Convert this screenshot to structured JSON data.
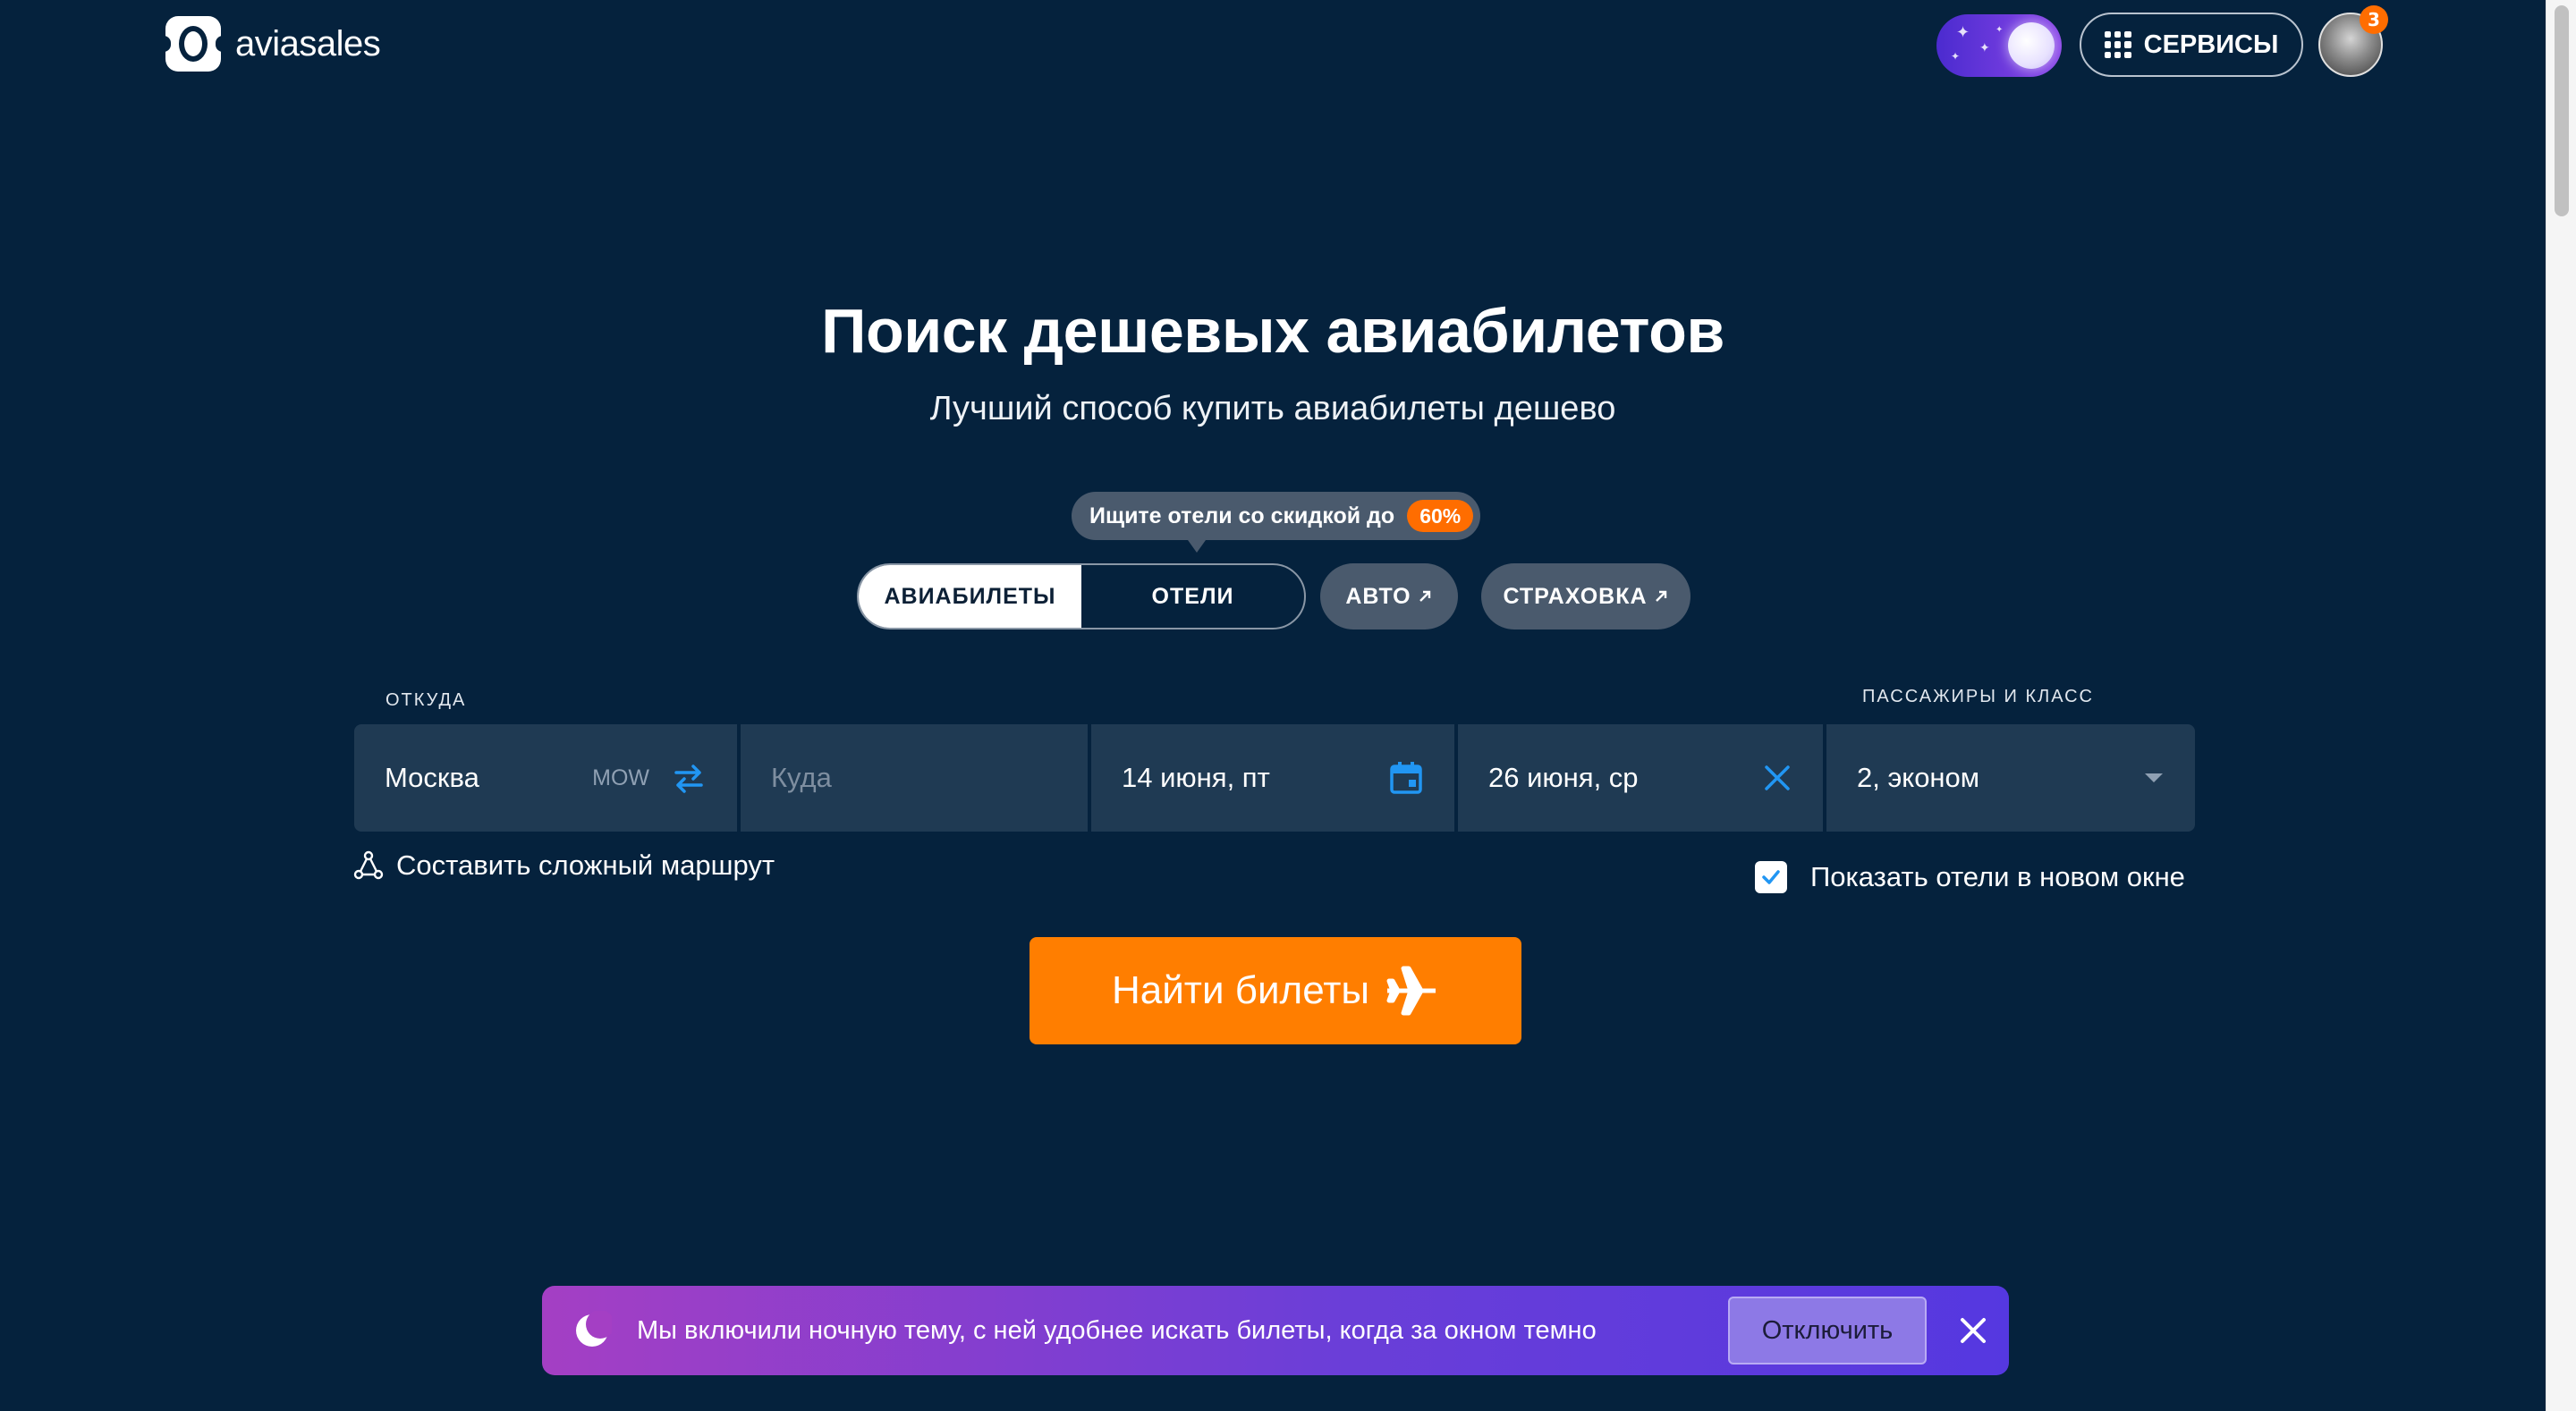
{
  "header": {
    "logo_text": "aviasales",
    "services_label": "СЕРВИСЫ",
    "notification_count": "3"
  },
  "hero": {
    "title": "Поиск дешевых авиабилетов",
    "subtitle": "Лучший способ купить авиабилеты дешево"
  },
  "promo": {
    "text": "Ищите отели со скидкой до",
    "discount": "60%"
  },
  "tabs": {
    "flights": "АВИАБИЛЕТЫ",
    "hotels": "ОТЕЛИ",
    "auto": "АВТО",
    "insurance": "СТРАХОВКА",
    "active": "flights"
  },
  "search": {
    "from_label": "ОТКУДА",
    "from_value": "Москва",
    "from_code": "MOW",
    "to_placeholder": "Куда",
    "depart_date": "14 июня, пт",
    "return_date": "26 июня, ср",
    "passengers_label": "ПАССАЖИРЫ И КЛАСС",
    "passengers_value": "2, эконом",
    "complex_route": "Составить сложный маршрут",
    "hotels_new_window": "Показать отели в новом окне",
    "hotels_new_window_checked": true,
    "submit": "Найти билеты"
  },
  "banner": {
    "text": "Мы включили ночную тему, с ней удобнее искать билеты, когда за окном темно",
    "disable_label": "Отключить"
  },
  "colors": {
    "background": "#05223d",
    "field": "#1f3a53",
    "accent_orange": "#ff7e00",
    "accent_blue": "#2196f3",
    "banner_start": "#a43fc4",
    "banner_end": "#5538e0"
  }
}
